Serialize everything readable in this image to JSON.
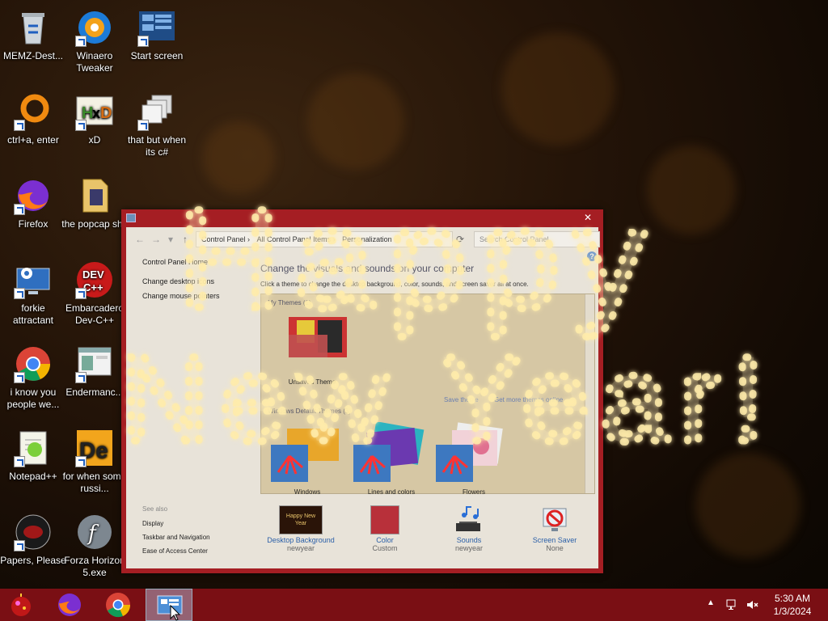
{
  "desktop": {
    "icons": [
      {
        "label": "MEMZ-Dest...",
        "icon": "recycle-bin-icon"
      },
      {
        "label": "Winaero Tweaker",
        "icon": "winaero-icon"
      },
      {
        "label": "Start screen",
        "icon": "start-screen-icon"
      },
      {
        "label": "ctrl+a, enter",
        "icon": "orange-ring-icon"
      },
      {
        "label": "xD",
        "icon": "hxd-icon"
      },
      {
        "label": "that but when its c#",
        "icon": "copy-windows-icon"
      },
      {
        "label": "Firefox",
        "icon": "firefox-icon"
      },
      {
        "label": "the popcap shit",
        "icon": "folder-icon"
      },
      {
        "label": "forkie attractant",
        "icon": "settings-monitor-icon"
      },
      {
        "label": "Embarcadero Dev-C++",
        "icon": "devcpp-icon"
      },
      {
        "label": "i know you people we...",
        "icon": "chrome-icon"
      },
      {
        "label": "Endermanc...",
        "icon": "window-app-icon"
      },
      {
        "label": "Notepad++",
        "icon": "notepadpp-icon"
      },
      {
        "label": "for when some russi...",
        "icon": "de-icon"
      },
      {
        "label": "Papers, Please",
        "icon": "papers-please-icon"
      },
      {
        "label": "Forza Horizon 5.exe",
        "icon": "flash-icon"
      }
    ]
  },
  "overlay": {
    "line1": "Happy",
    "line2": "New Year!"
  },
  "window": {
    "close": "✕",
    "breadcrumb": [
      "Control Panel",
      "All Control Panel Items",
      "Personalization"
    ],
    "search_placeholder": "Search Control Panel",
    "left_links": [
      "Control Panel Home",
      "Change desktop icons",
      "Change mouse pointers"
    ],
    "title": "Change the visuals and sounds on your computer",
    "subtitle": "Click a theme to change the desktop background, color, sounds, and screen saver all at once.",
    "my_themes_label": "My Themes (1)",
    "unsaved_theme": "Unsaved Theme",
    "save_theme": "Save theme",
    "get_more": "Get more themes online",
    "default_themes_label": "Windows Default Themes (3)",
    "default_themes": [
      "Windows",
      "Lines and colors",
      "Flowers"
    ],
    "see_also_label": "See also",
    "see_also": [
      "Display",
      "Taskbar and Navigation",
      "Ease of Access Center"
    ],
    "bottom_items": [
      {
        "label": "Desktop Background",
        "value": "newyear",
        "thumb_text": "Happy New Year"
      },
      {
        "label": "Color",
        "value": "Custom"
      },
      {
        "label": "Sounds",
        "value": "newyear"
      },
      {
        "label": "Screen Saver",
        "value": "None"
      }
    ]
  },
  "taskbar": {
    "time": "5:30 AM",
    "date": "1/3/2024",
    "color": "#7a0f14"
  },
  "colors": {
    "window_frame": "#a51e23",
    "link": "#2a5fa8"
  }
}
